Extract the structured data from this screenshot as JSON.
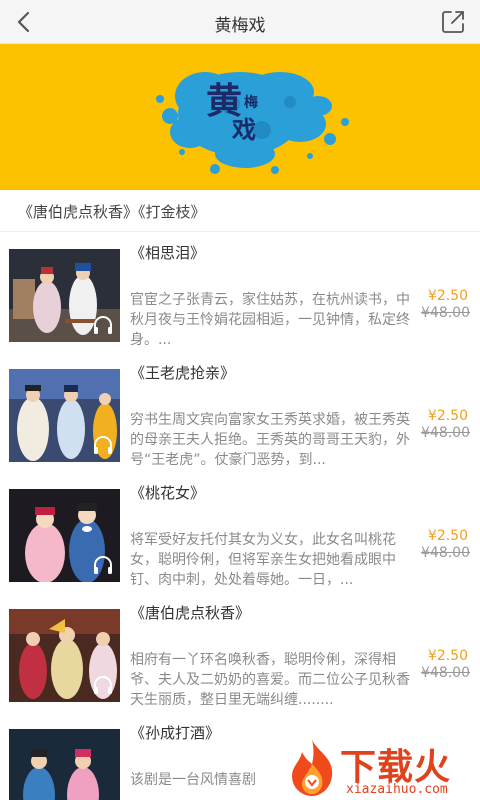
{
  "header": {
    "title": "黄梅戏",
    "back_icon": "chevron-left-icon",
    "share_icon": "share-icon"
  },
  "banner": {
    "text_main": "黄",
    "text_small": "梅",
    "text_bottom": "戏",
    "colors": {
      "background": "#fcc200",
      "splash": "#2a9fd8"
    }
  },
  "subtitle": "《唐伯虎点秋香》《打金枝》",
  "items": [
    {
      "name": "《相思泪》",
      "price": "¥2.50",
      "original_price": "¥48.00",
      "desc": "官宦之子张青云，家住姑苏，在杭州读书，中秋月夜与王怜娟花园相逅，一见钟情，私定终身。..."
    },
    {
      "name": "《王老虎抢亲》",
      "price": "¥2.50",
      "original_price": "¥48.00",
      "desc": "穷书生周文宾向富家女王秀英求婚，被王秀英的母亲王夫人拒绝。王秀英的哥哥王天豹，外号“王老虎”。仗豪门恶势，到..."
    },
    {
      "name": "《桃花女》",
      "price": "¥2.50",
      "original_price": "¥48.00",
      "desc": "将军受好友托付其女为义女，此女名叫桃花女，聪明伶俐，但将军亲生女把她看成眼中钉、肉中刺，处处着辱她。一日，..."
    },
    {
      "name": "《唐伯虎点秋香》",
      "price": "¥2.50",
      "original_price": "¥48.00",
      "desc": "相府有一丫环名唤秋香，聪明伶俐，深得相爷、夫人及二奶奶的喜爱。而二位公子见秋香天生丽质，整日里无端纠缠........"
    },
    {
      "name": "《孙成打酒》",
      "price": "",
      "original_price": "",
      "desc": "该剧是一台风情喜剧"
    }
  ],
  "watermark": {
    "text": "下载火",
    "url": "xiazaihuo.com",
    "color": "#e0421c"
  }
}
